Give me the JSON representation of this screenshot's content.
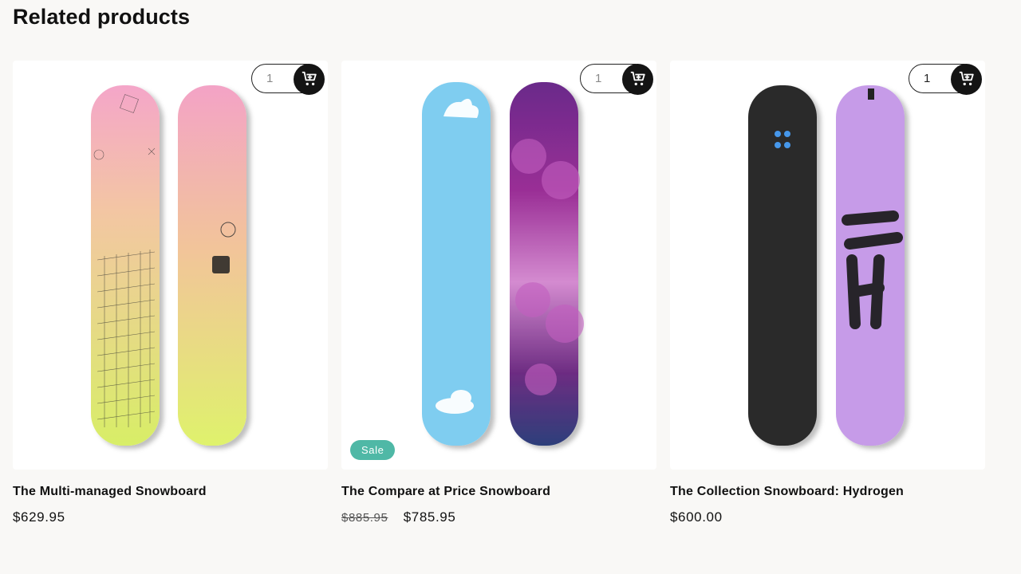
{
  "section": {
    "title": "Related products"
  },
  "products": [
    {
      "title": "The Multi-managed Snowboard",
      "price": "$629.95",
      "compare_price": "",
      "badge": "",
      "quantity": "1",
      "cart_icon": "add-to-cart-icon",
      "board_colors": [
        "#f3a9c8",
        "#dcef6a"
      ]
    },
    {
      "title": "The Compare at Price Snowboard",
      "price": "$785.95",
      "compare_price": "$885.95",
      "badge": "Sale",
      "quantity": "1",
      "cart_icon": "add-to-cart-icon",
      "board_colors": [
        "#7fcdf0",
        "#7b2e8e"
      ]
    },
    {
      "title": "The Collection Snowboard: Hydrogen",
      "price": "$600.00",
      "compare_price": "",
      "badge": "",
      "quantity": "1",
      "cart_icon": "add-to-cart-icon",
      "board_colors": [
        "#2b2b2b",
        "#c69be8"
      ]
    }
  ],
  "colors": {
    "background": "#f9f8f6",
    "cart_button": "#141414",
    "sale_badge": "#4fb8a6"
  }
}
